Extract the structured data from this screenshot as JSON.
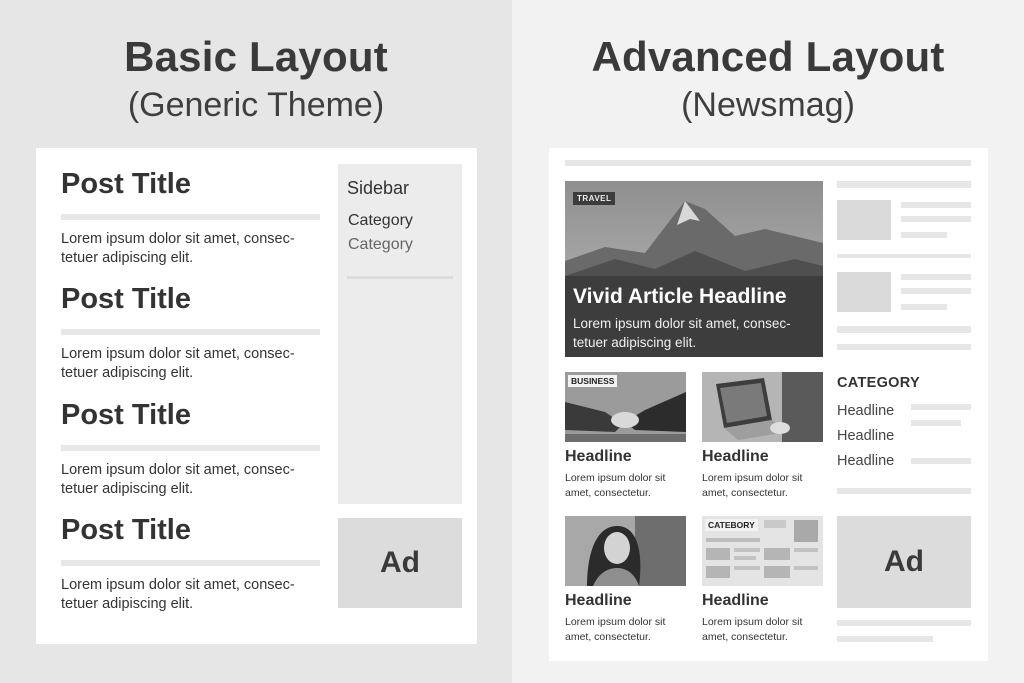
{
  "basic": {
    "title": "Basic Layout",
    "subtitle": "(Generic Theme)",
    "posts": [
      {
        "title": "Post Title",
        "text": "Lorem ipsum dolor sit amet, consec-tetuer adipiscing elit."
      },
      {
        "title": "Post Title",
        "text": "Lorem ipsum dolor sit amet, consec-tetuer adipiscing elit."
      },
      {
        "title": "Post Title",
        "text": "Lorem ipsum dolor sit amet, consec-tetuer adipiscing elit."
      },
      {
        "title": "Post Title",
        "text": "Lorem ipsum dolor sit amet, consec-tetuer adipiscing elit."
      }
    ],
    "sidebar": {
      "title": "Sidebar",
      "category_active": "Category",
      "category": "Category"
    },
    "ad": "Ad"
  },
  "advanced": {
    "title": "Advanced Layout",
    "subtitle": "(Newsmag)",
    "hero": {
      "tag": "TRAVEL",
      "headline": "Vivid Article Headline",
      "text": "Lorem ipsum dolor sit amet, consec-tetuer adipiscing elit."
    },
    "cards": [
      {
        "tag": "BUSINESS",
        "headline": "Headline",
        "text": "Lorem ipsum dolor sit amet, consectetur."
      },
      {
        "tag": "",
        "headline": "Headline",
        "text": "Lorem ipsum dolor sit amet, consectetur."
      },
      {
        "tag": "",
        "headline": "Headline",
        "text": "Lorem ipsum dolor sit amet, consectetur."
      },
      {
        "tag": "CATEBORY",
        "headline": "Headline",
        "text": "Lorem ipsum dolor sit amet, consectetur."
      }
    ],
    "category": {
      "title": "CATEGORY",
      "links": [
        "Headline",
        "Headline",
        "Headline"
      ]
    },
    "ad": "Ad"
  },
  "colors": {
    "background_left": "#e6e6e6",
    "background_right": "#f2f2f2",
    "card": "#ffffff",
    "placeholder": "#dcdcdc"
  }
}
